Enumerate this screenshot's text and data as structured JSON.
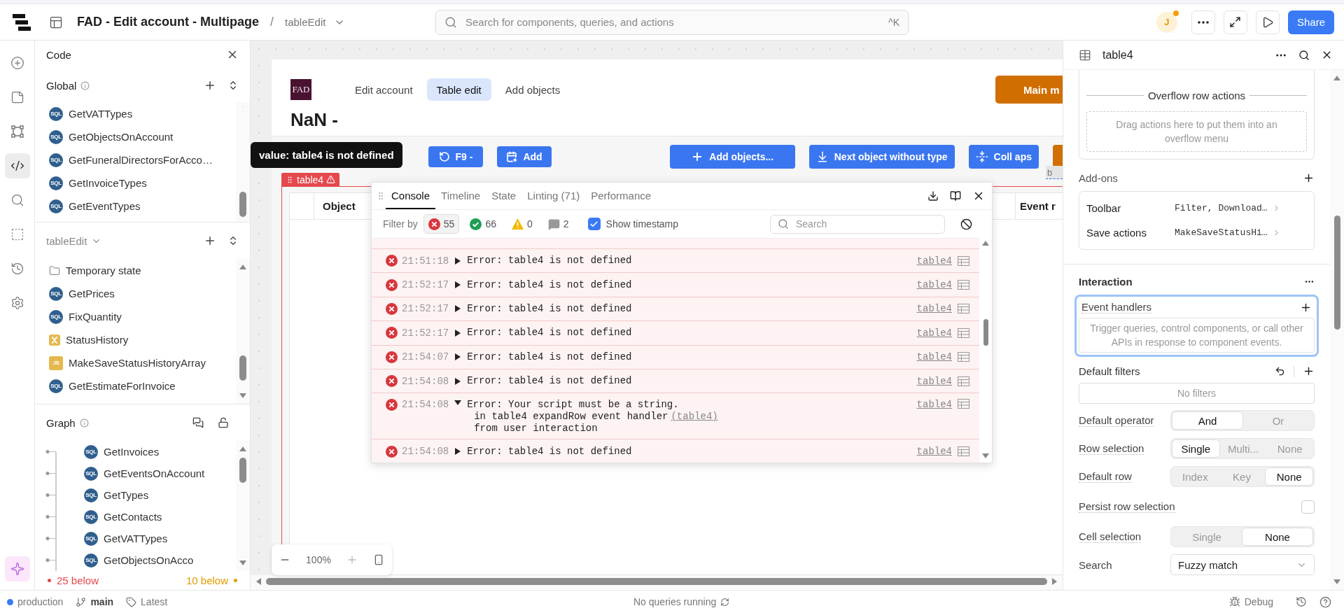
{
  "topbar": {
    "title": "FAD - Edit account - Multipage",
    "separator": "/",
    "page": "tableEdit",
    "search": {
      "placeholder": "Search for components, queries, and actions",
      "shortcut": "^K"
    },
    "avatar": "J",
    "share": "Share"
  },
  "rail": [
    {
      "kind": "add",
      "selected": false
    },
    {
      "kind": "pages",
      "selected": false
    },
    {
      "kind": "frame",
      "selected": false
    },
    {
      "kind": "code",
      "selected": true
    },
    {
      "kind": "search",
      "selected": false
    },
    {
      "kind": "box",
      "selected": false
    },
    {
      "kind": "history",
      "selected": false
    },
    {
      "kind": "settings",
      "selected": false
    },
    {
      "kind": "assist",
      "selected": false
    }
  ],
  "code_panel": {
    "title": "Code",
    "global": {
      "title": "Global",
      "items": [
        {
          "kind": "sql",
          "badge": "SQL",
          "label": "GetVATTypes"
        },
        {
          "kind": "sql",
          "badge": "SQL",
          "label": "GetObjectsOnAccount"
        },
        {
          "kind": "sql",
          "badge": "SQL",
          "label": "GetFuneralDirectorsForAcco…"
        },
        {
          "kind": "sql",
          "badge": "SQL",
          "label": "GetInvoiceTypes"
        },
        {
          "kind": "sql",
          "badge": "SQL",
          "label": "GetEventTypes"
        }
      ]
    },
    "page": {
      "title": "tableEdit",
      "items": [
        {
          "kind": "folder",
          "label": "Temporary state"
        },
        {
          "kind": "sql",
          "badge": "SQL",
          "label": "GetPrices"
        },
        {
          "kind": "sql",
          "badge": "SQL",
          "label": "FixQuantity"
        },
        {
          "kind": "variable",
          "label": "StatusHistory"
        },
        {
          "kind": "js",
          "badge": "JS",
          "label": "MakeSaveStatusHistoryArray"
        },
        {
          "kind": "sql",
          "badge": "SQL",
          "label": "GetEstimateForInvoice"
        }
      ]
    },
    "graph": {
      "title": "Graph",
      "items": [
        {
          "kind": "sql",
          "badge": "SQL",
          "label": "GetInvoices"
        },
        {
          "kind": "sql",
          "badge": "SQL",
          "label": "GetEventsOnAccount"
        },
        {
          "kind": "sql",
          "badge": "SQL",
          "label": "GetTypes"
        },
        {
          "kind": "sql",
          "badge": "SQL",
          "label": "GetContacts"
        },
        {
          "kind": "sql",
          "badge": "SQL",
          "label": "GetVATTypes"
        },
        {
          "kind": "sql",
          "badge": "SQL",
          "label": "GetObjectsOnAcco"
        }
      ],
      "above_count": "25 below",
      "below_count": "10 below"
    }
  },
  "canvas": {
    "logo": "FAD",
    "tabs": [
      {
        "label": "Edit account",
        "selected": false
      },
      {
        "label": "Table edit",
        "selected": true
      },
      {
        "label": "Add objects",
        "selected": false
      }
    ],
    "main_button": "Main m",
    "heading": "NaN -",
    "tooltip": "value: table4 is not defined",
    "left_buttons": [
      {
        "kind": "refresh",
        "label": "F9 -",
        "color": "#3a76f0"
      },
      {
        "kind": "calendar",
        "label": "Add",
        "color": "#3a76f0"
      }
    ],
    "right_buttons": [
      {
        "kind": "add",
        "label": "Add objects...",
        "color": "#3a76f0"
      },
      {
        "kind": "download",
        "label": "Next object without type",
        "color": "#3a76f0"
      },
      {
        "kind": "collapse",
        "label": "Coll aps",
        "color": "#3a76f0"
      },
      {
        "kind": "none",
        "color": "#d06f00"
      }
    ],
    "side_tag": "b",
    "table": {
      "tag": "table4",
      "columns": [
        "Object",
        "Event r"
      ]
    },
    "zoom": "100%"
  },
  "console": {
    "tabs": [
      {
        "label": "Console",
        "selected": true
      },
      {
        "label": "Timeline",
        "selected": false
      },
      {
        "label": "State",
        "selected": false
      },
      {
        "label": "Linting (71)",
        "selected": false
      },
      {
        "label": "Performance",
        "selected": false
      }
    ],
    "filter_label": "Filter by",
    "filters": [
      {
        "kind": "error",
        "count": "55",
        "selected": true
      },
      {
        "kind": "success",
        "count": "66",
        "selected": false
      },
      {
        "kind": "warning",
        "count": "0",
        "selected": false
      },
      {
        "kind": "message",
        "count": "2",
        "selected": false
      }
    ],
    "timestamp": {
      "label": "Show timestamp",
      "checked": true
    },
    "search": {
      "placeholder": "Search"
    },
    "rows": [
      {
        "time": "21:51:18",
        "message": "Error: table4 is not defined",
        "source": "table4",
        "expanded": false
      },
      {
        "time": "21:52:17",
        "message": "Error: table4 is not defined",
        "source": "table4",
        "expanded": false
      },
      {
        "time": "21:52:17",
        "message": "Error: table4 is not defined",
        "source": "table4",
        "expanded": false
      },
      {
        "time": "21:52:17",
        "message": "Error: table4 is not defined",
        "source": "table4",
        "expanded": false
      },
      {
        "time": "21:54:07",
        "message": "Error: table4 is not defined",
        "source": "table4",
        "expanded": false
      },
      {
        "time": "21:54:08",
        "message": "Error: table4 is not defined",
        "source": "table4",
        "expanded": false
      },
      {
        "time": "21:54:08",
        "message": "Error: Your script must be a string.",
        "source": "table4",
        "expanded": true,
        "details": [
          {
            "text": "in table4 expandRow event handler",
            "link": "(table4)"
          },
          {
            "text": "from user interaction"
          }
        ]
      },
      {
        "time": "21:54:08",
        "message": "Error: table4 is not defined",
        "source": "table4",
        "expanded": false
      }
    ]
  },
  "inspector": {
    "title": "table4",
    "overflow": {
      "title": "Overflow row actions",
      "hint": "Drag actions here to put them into an overflow menu"
    },
    "addons": {
      "title": "Add-ons",
      "items": [
        {
          "label": "Toolbar",
          "value": "Filter, Download…"
        },
        {
          "label": "Save actions",
          "value": "MakeSaveStatusHi…"
        }
      ]
    },
    "interaction": {
      "title": "Interaction",
      "event_handlers": {
        "label": "Event handlers",
        "hint": "Trigger queries, control components, or call other APIs in response to component events."
      },
      "default_filters": {
        "label": "Default filters",
        "empty": "No filters"
      },
      "settings": [
        {
          "kind": "segmented",
          "label": "Default operator",
          "options": [
            {
              "label": "And",
              "selected": true
            },
            {
              "label": "Or",
              "selected": false
            }
          ]
        },
        {
          "kind": "segmented",
          "label": "Row selection",
          "options": [
            {
              "label": "Single",
              "selected": true
            },
            {
              "label": "Multi...",
              "selected": false
            },
            {
              "label": "None",
              "selected": false
            }
          ]
        },
        {
          "kind": "segmented",
          "label": "Default row",
          "options": [
            {
              "label": "Index",
              "selected": false
            },
            {
              "label": "Key",
              "selected": false
            },
            {
              "label": "None",
              "selected": true
            }
          ]
        },
        {
          "kind": "checkbox",
          "label": "Persist row selection",
          "checked": false
        },
        {
          "kind": "segmented",
          "label": "Cell selection",
          "options": [
            {
              "label": "Single",
              "selected": false
            },
            {
              "label": "None",
              "selected": true
            }
          ]
        },
        {
          "kind": "select",
          "label": "Search",
          "value": "Fuzzy match"
        }
      ]
    }
  },
  "status_bar": {
    "environment": "production",
    "branch": "main",
    "tag": "Latest",
    "status": "No queries running",
    "debug": "Debug"
  }
}
